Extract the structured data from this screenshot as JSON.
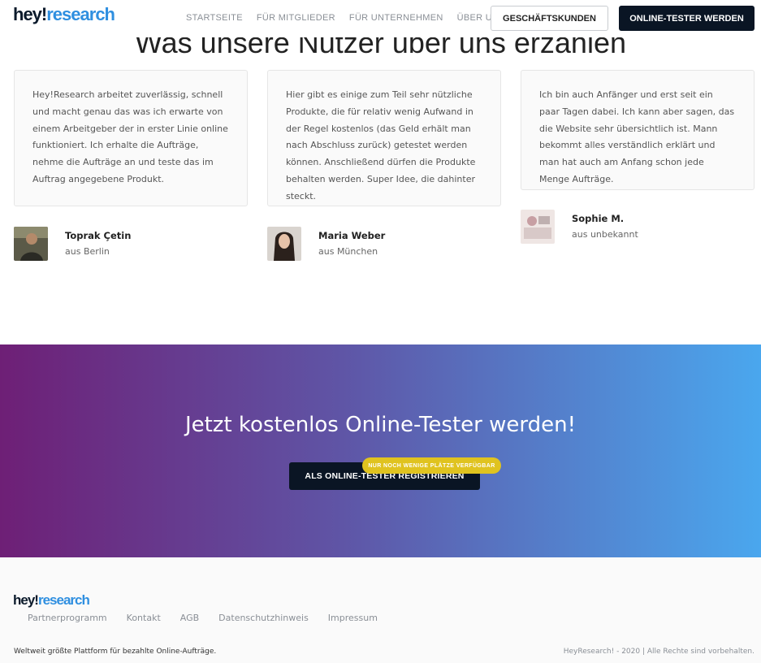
{
  "header": {
    "logo_hey": "hey!",
    "logo_research": "research",
    "nav": [
      "STARTSEITE",
      "FÜR MITGLIEDER",
      "FÜR UNTERNEHMEN",
      "ÜBER UNS"
    ],
    "business_button": "GESCHÄFTSKUNDEN",
    "tester_button": "ONLINE-TESTER WERDEN"
  },
  "testimonials": {
    "title": "Was unsere Nutzer über uns erzählen",
    "items": [
      {
        "text": "Hey!Research arbeitet zuverlässig, schnell und macht genau das was ich erwarte von einem Arbeitgeber der in erster Linie online funktioniert. Ich erhalte die Aufträge, nehme die Aufträge an und teste das im Auftrag angegebene Produkt.",
        "name": "Toprak Çetin",
        "location": "aus Berlin"
      },
      {
        "text": "Hier gibt es einige zum Teil sehr nützliche Produkte, die für relativ wenig Aufwand in der Regel kostenlos (das Geld erhält man nach Abschluss zurück) getestet werden können. Anschließend dürfen die Produkte behalten werden. Super Idee, die dahinter steckt.",
        "name": "Maria Weber",
        "location": "aus München"
      },
      {
        "text": "Ich bin auch Anfänger und erst seit ein paar Tagen dabei. Ich kann aber sagen, das die Website sehr übersichtlich ist. Mann bekommt alles verständlich erklärt und man hat auch am Anfang schon jede Menge Aufträge.",
        "name": "Sophie M.",
        "location": "aus unbekannt"
      }
    ]
  },
  "cta": {
    "title": "Jetzt kostenlos Online-Tester werden!",
    "button": "ALS ONLINE-TESTER REGISTRIEREN",
    "badge": "NUR NOCH WENIGE PLÄTZE VERFÜGBAR"
  },
  "footer": {
    "logo_hey": "hey!",
    "logo_research": "research",
    "links": [
      "Partnerprogramm",
      "Kontakt",
      "AGB",
      "Datenschutzhinweis",
      "Impressum"
    ],
    "tagline": "Weltweit größte Plattform für bezahlte Online-Aufträge.",
    "copyright": "HeyResearch! - 2020 | Alle Rechte sind vorbehalten."
  },
  "colors": {
    "brand_dark": "#0a1524",
    "brand_blue": "#2f8fe0",
    "gradient_start": "#6e1f76",
    "gradient_end": "#4aa7ee",
    "badge": "#e0c31f"
  }
}
